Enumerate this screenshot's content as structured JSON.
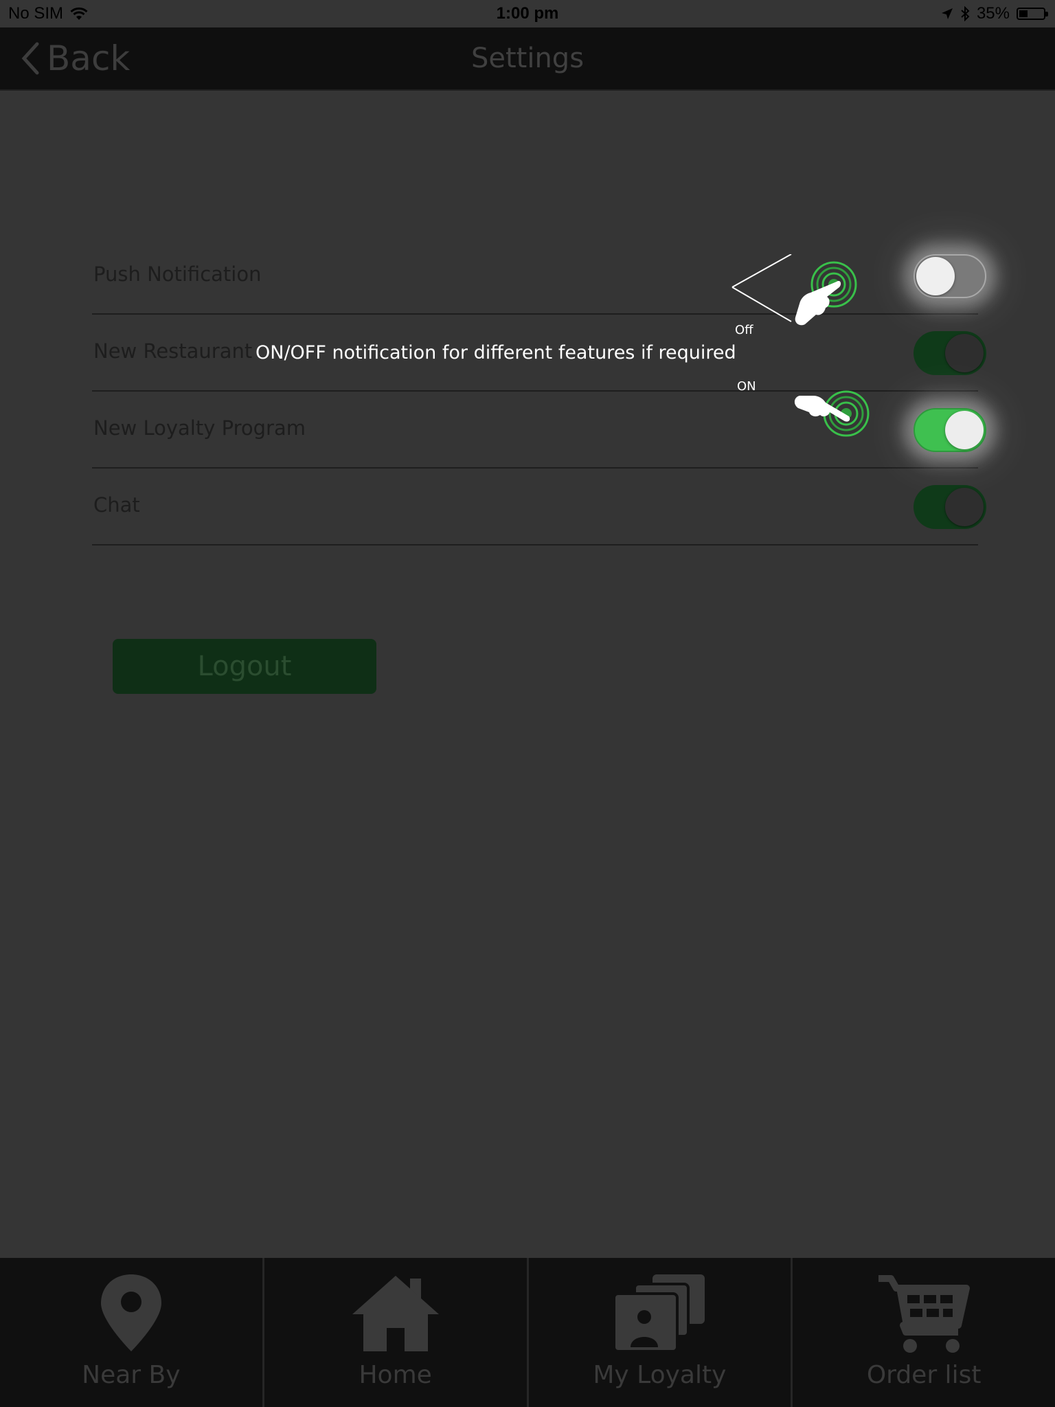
{
  "status_bar": {
    "carrier": "No SIM",
    "time": "1:00 pm",
    "battery_text": "35%",
    "battery_level": 0.35
  },
  "nav": {
    "back_label": "Back",
    "title": "Settings"
  },
  "settings": [
    {
      "label": "Push Notification",
      "state": "off"
    },
    {
      "label": "New Restaurant",
      "state": "on"
    },
    {
      "label": "New Loyalty Program",
      "state": "on"
    },
    {
      "label": "Chat",
      "state": "on"
    }
  ],
  "annotation": {
    "text": "ON/OFF notification for different features if required",
    "off_label": "Off",
    "on_label": "ON"
  },
  "logout": {
    "label": "Logout"
  },
  "tabs": [
    {
      "label": "Near By",
      "icon": "location-pin-icon"
    },
    {
      "label": "Home",
      "icon": "home-icon"
    },
    {
      "label": "My Loyalty",
      "icon": "loyalty-cards-icon"
    },
    {
      "label": "Order list",
      "icon": "shopping-cart-icon"
    }
  ],
  "colors": {
    "background": "#353535",
    "nav_bar": "#0f0f0f",
    "toggle_on": "#3fc050",
    "toggle_on_dim": "#0f3a19",
    "logout_bg": "#0f2f16",
    "pointer_ring": "#39c04a"
  }
}
